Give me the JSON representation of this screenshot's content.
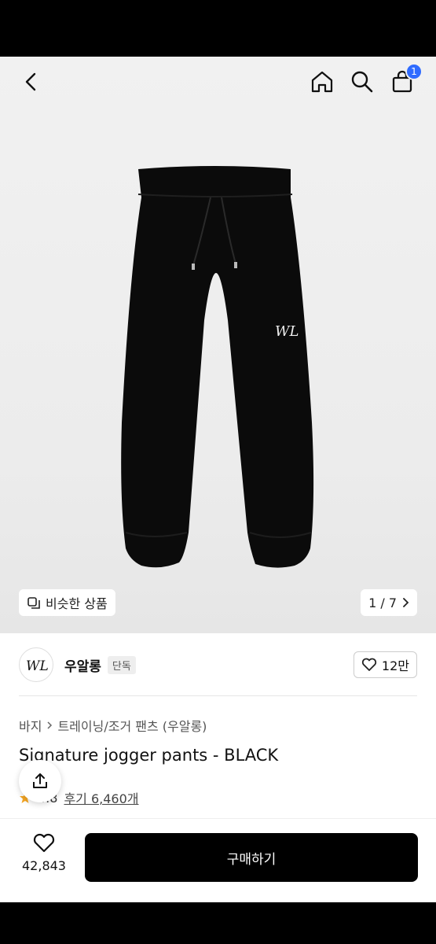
{
  "cart": {
    "badge": "1"
  },
  "hero": {
    "similar_label": "비슷한 상품",
    "pager": "1 / 7"
  },
  "brand": {
    "name": "우알롱",
    "tag": "단독",
    "likes": "12만",
    "logo_text": "WL"
  },
  "product": {
    "breadcrumb": [
      "바지",
      "트레이닝/조거 팬츠 (우알롱)"
    ],
    "title": "Signature jogger pants - BLACK",
    "rating": "4.8",
    "reviews": "후기 6,460개"
  },
  "bottom": {
    "wish_count": "42,843",
    "buy_label": "구매하기"
  },
  "colors": {
    "accent": "#2f6bff",
    "buy_button": "#000000",
    "star": "#f5a623"
  }
}
